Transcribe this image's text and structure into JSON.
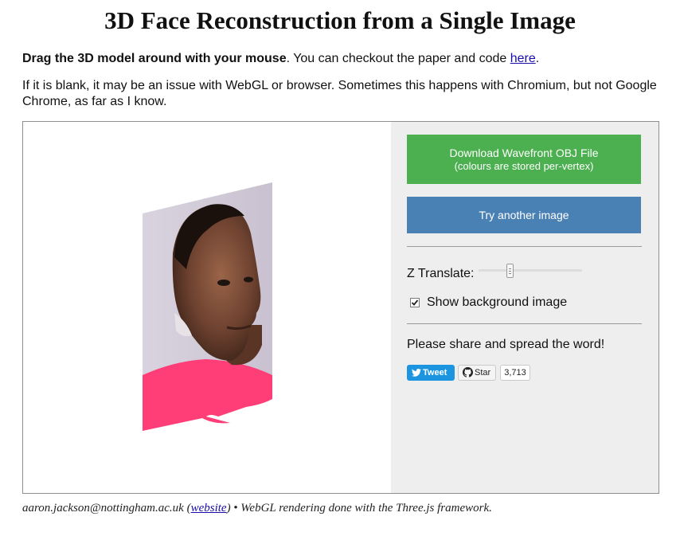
{
  "title": "3D Face Reconstruction from a Single Image",
  "intro": {
    "bold_lead": "Drag the 3D model around with your mouse",
    "text_after_bold": ". You can checkout the paper and code ",
    "link_text": "here",
    "end_period": ".",
    "warning": "If it is blank, it may be an issue with WebGL or browser. Sometimes this happens with Chromium, but not Google Chrome, as far as I know."
  },
  "viewer": {
    "model_icon": "3d-face-model"
  },
  "panel": {
    "download_label_line1": "Download Wavefront OBJ File",
    "download_label_line2": "(colours are stored per-vertex)",
    "try_label": "Try another image",
    "z_translate_label": "Z Translate:",
    "z_translate_level": 0.3,
    "show_bg_label": "Show background image",
    "show_bg_checked": true,
    "share_text": "Please share and spread the word!",
    "tweet_label": "Tweet",
    "star_label": "Star",
    "star_count": "3,713"
  },
  "footer": {
    "email": "aaron.jackson@nottingham.ac.uk",
    "open_paren": " (",
    "website_link": "website",
    "rest": ") • WebGL rendering done with the Three.js framework."
  },
  "colors": {
    "download_button": "#4cb050",
    "try_button": "#4a81b4",
    "panel_bg": "#eeeeee",
    "tweet_button": "#1b95e0",
    "shirt": "#ff3e78"
  }
}
